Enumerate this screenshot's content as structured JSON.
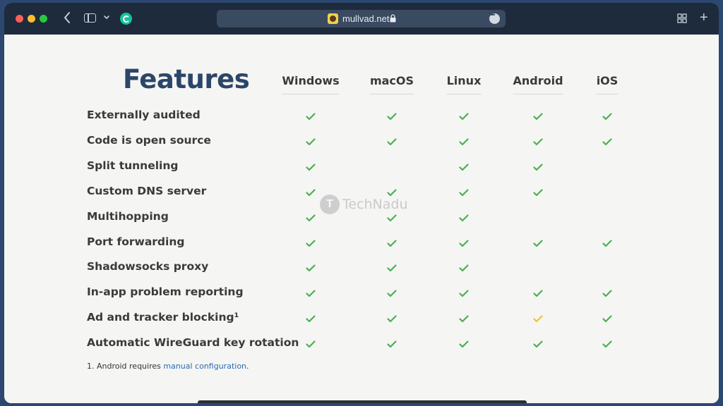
{
  "browser": {
    "url": "mullvad.net",
    "icons": [
      "back-icon",
      "sidebar-icon",
      "chevron-down-icon",
      "grammarly-icon",
      "lock-icon",
      "more-icon",
      "tabs-overview-icon",
      "new-tab-icon"
    ]
  },
  "page": {
    "title": "Features",
    "columns": [
      "Windows",
      "macOS",
      "Linux",
      "Android",
      "iOS"
    ],
    "rows": [
      {
        "label": "Externally audited",
        "support": [
          "yes",
          "yes",
          "yes",
          "yes",
          "yes"
        ]
      },
      {
        "label": "Code is open source",
        "support": [
          "yes",
          "yes",
          "yes",
          "yes",
          "yes"
        ]
      },
      {
        "label": "Split tunneling",
        "support": [
          "yes",
          "no",
          "yes",
          "yes",
          "no"
        ]
      },
      {
        "label": "Custom DNS server",
        "support": [
          "yes",
          "yes",
          "yes",
          "yes",
          "no"
        ]
      },
      {
        "label": "Multihopping",
        "support": [
          "yes",
          "yes",
          "yes",
          "no",
          "no"
        ]
      },
      {
        "label": "Port forwarding",
        "support": [
          "yes",
          "yes",
          "yes",
          "yes",
          "yes"
        ]
      },
      {
        "label": "Shadowsocks proxy",
        "support": [
          "yes",
          "yes",
          "yes",
          "no",
          "no"
        ]
      },
      {
        "label": "In-app problem reporting",
        "support": [
          "yes",
          "yes",
          "yes",
          "yes",
          "yes"
        ]
      },
      {
        "label": "Ad and tracker blocking¹",
        "support": [
          "yes",
          "yes",
          "yes",
          "partial",
          "yes"
        ]
      },
      {
        "label": "Automatic WireGuard key rotation",
        "support": [
          "yes",
          "yes",
          "yes",
          "yes",
          "yes"
        ]
      }
    ],
    "footnote": {
      "prefix": "1. Android requires ",
      "link_text": "manual configuration",
      "suffix": "."
    },
    "watermark": {
      "logo_letter": "T",
      "text": "TechNadu"
    }
  },
  "colors": {
    "check_yes": "#4caf50",
    "check_partial": "#f2c12e",
    "title": "#2b4668"
  }
}
